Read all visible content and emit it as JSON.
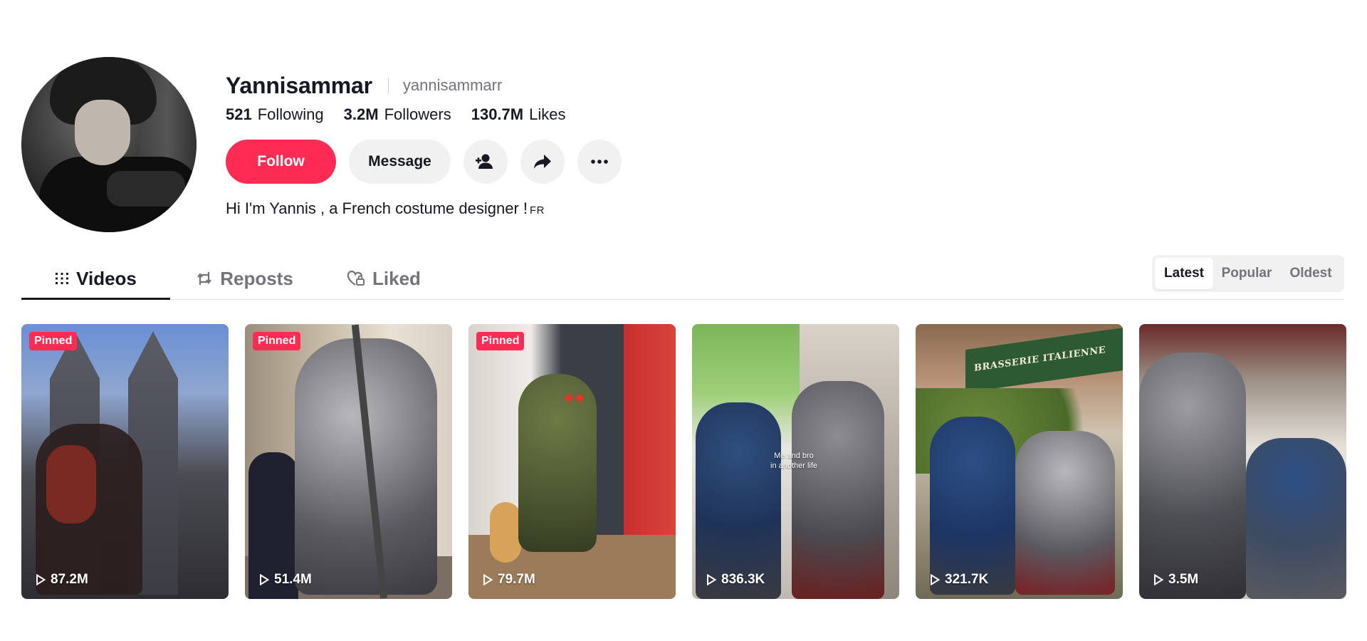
{
  "profile": {
    "display_name": "Yannisammar",
    "username": "yannisammarr",
    "stats": [
      {
        "value": "521",
        "label": "Following"
      },
      {
        "value": "3.2M",
        "label": "Followers"
      },
      {
        "value": "130.7M",
        "label": "Likes"
      }
    ],
    "follow_label": "Follow",
    "message_label": "Message",
    "bio": "Hi I'm Yannis , a French costume designer !",
    "bio_flag": "FR"
  },
  "tabs": [
    {
      "label": "Videos",
      "icon": "grid-icon",
      "active": true
    },
    {
      "label": "Reposts",
      "icon": "repost-icon",
      "active": false
    },
    {
      "label": "Liked",
      "icon": "heart-lock-icon",
      "active": false
    }
  ],
  "sort": {
    "options": [
      "Latest",
      "Popular",
      "Oldest"
    ],
    "selected": "Latest"
  },
  "pinned_label": "Pinned",
  "videos": [
    {
      "pinned": true,
      "views": "87.2M",
      "caption": ""
    },
    {
      "pinned": true,
      "views": "51.4M",
      "caption": ""
    },
    {
      "pinned": true,
      "views": "79.7M",
      "caption": ""
    },
    {
      "pinned": false,
      "views": "836.3K",
      "caption": "Me and bro\nin another life"
    },
    {
      "pinned": false,
      "views": "321.7K",
      "caption": "",
      "sign": "BRASSERIE ITALIENNE"
    },
    {
      "pinned": false,
      "views": "3.5M",
      "caption": ""
    }
  ],
  "colors": {
    "accent": "#fe2c55",
    "text": "#161823",
    "muted": "#73747b",
    "button_bg": "#f1f1f2"
  }
}
